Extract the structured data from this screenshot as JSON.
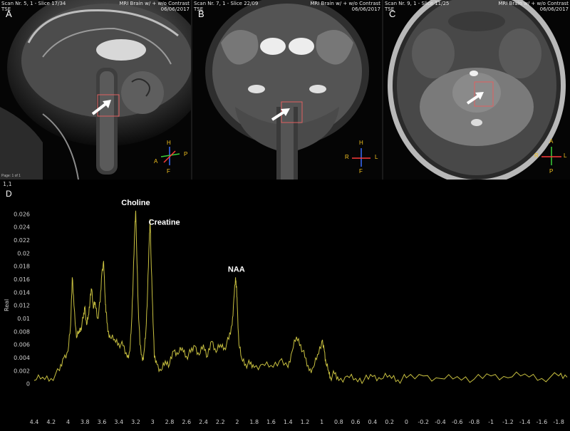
{
  "panels": [
    {
      "id": "A",
      "label": "A",
      "header_left_1": "Scan Nr. 5, 1 - Slice 17/34",
      "header_left_2": "TSE",
      "header_right_1": "MRI Brain w/ + w/o Contrast",
      "header_right_2": "06/06/2017",
      "orientation": {
        "top": "H",
        "left": "A",
        "right": "P",
        "bottom": "F"
      },
      "page_text": "Page: 1 of 1"
    },
    {
      "id": "B",
      "label": "B",
      "header_left_1": "Scan Nr. 7, 1 - Slice 22/09",
      "header_left_2": "TSE",
      "header_right_1": "MRI Brain w/ + w/o Contrast",
      "header_right_2": "06/06/2017",
      "orientation": {
        "top": "H",
        "left": "R",
        "right": "L",
        "bottom": "F"
      }
    },
    {
      "id": "C",
      "label": "C",
      "header_left_1": "Scan Nr. 9, 1 - Slice 11/25",
      "header_left_2": "TSE",
      "header_right_1": "MRI Brain w/ + w/o Contrast",
      "header_right_2": "06/06/2017",
      "orientation": {
        "top": "A",
        "left": "R",
        "right": "L",
        "bottom": "P"
      }
    }
  ],
  "spectrum": {
    "label": "D",
    "corner_text": "1,1",
    "ylabel": "Real",
    "peaks": [
      {
        "name": "Choline",
        "ppm": 3.2
      },
      {
        "name": "Creatine",
        "ppm": 3.03
      },
      {
        "name": "NAA",
        "ppm": 2.01
      }
    ]
  },
  "chart_data": {
    "type": "line",
    "title": "",
    "xlabel": "",
    "ylabel": "Real",
    "xlim": [
      4.4,
      -1.9
    ],
    "ylim": [
      -0.002,
      0.028
    ],
    "x_reversed": true,
    "xticks": [
      "4.4",
      "4.2",
      "4",
      "3.8",
      "3.6",
      "3.4",
      "3.2",
      "3",
      "2.8",
      "2.6",
      "2.4",
      "2.2",
      "2",
      "1.8",
      "1.6",
      "1.4",
      "1.2",
      "1",
      "0.8",
      "0.6",
      "0.4",
      "0.2",
      "0",
      "-0.2",
      "-0.4",
      "-0.6",
      "-0.8",
      "-1",
      "-1.2",
      "-1.4",
      "-1.6",
      "-1.8"
    ],
    "yticks": [
      "0",
      "0.002",
      "0.004",
      "0.006",
      "0.008",
      "0.01",
      "0.012",
      "0.014",
      "0.016",
      "0.018",
      "0.02",
      "0.022",
      "0.024",
      "0.026"
    ],
    "line_color": "#c8c040",
    "series": [
      {
        "x": [
          4.4,
          4.3,
          4.2,
          4.1,
          4.05,
          4.0,
          3.97,
          3.95,
          3.93,
          3.9,
          3.87,
          3.85,
          3.82,
          3.8,
          3.78,
          3.76,
          3.74,
          3.72,
          3.7,
          3.68,
          3.65,
          3.62,
          3.6,
          3.58,
          3.56,
          3.55,
          3.53,
          3.5,
          3.45,
          3.4,
          3.35,
          3.3,
          3.27,
          3.25,
          3.23,
          3.21,
          3.2,
          3.19,
          3.17,
          3.15,
          3.12,
          3.1,
          3.08,
          3.06,
          3.04,
          3.03,
          3.02,
          3.0,
          2.98,
          2.95,
          2.9,
          2.85,
          2.8,
          2.75,
          2.7,
          2.65,
          2.6,
          2.55,
          2.5,
          2.45,
          2.4,
          2.35,
          2.3,
          2.25,
          2.2,
          2.15,
          2.1,
          2.06,
          2.04,
          2.02,
          2.01,
          2.0,
          1.98,
          1.95,
          1.9,
          1.85,
          1.8,
          1.7,
          1.6,
          1.5,
          1.4,
          1.35,
          1.3,
          1.25,
          1.2,
          1.15,
          1.1,
          1.05,
          1.0,
          0.97,
          0.95,
          0.92,
          0.9,
          0.85,
          0.8,
          0.7,
          0.6,
          0.5,
          0.4,
          0.3,
          0.2,
          0.1,
          0.0,
          -0.2,
          -0.4,
          -0.6,
          -0.8,
          -1.0,
          -1.2,
          -1.4,
          -1.6,
          -1.8,
          -1.9
        ],
        "y": [
          0.0005,
          0.001,
          0.0008,
          0.002,
          0.004,
          0.005,
          0.009,
          0.0163,
          0.012,
          0.007,
          0.008,
          0.0085,
          0.01,
          0.0118,
          0.009,
          0.0105,
          0.0128,
          0.0145,
          0.0115,
          0.0125,
          0.01,
          0.0125,
          0.017,
          0.0188,
          0.013,
          0.011,
          0.008,
          0.007,
          0.0068,
          0.0062,
          0.0058,
          0.004,
          0.005,
          0.009,
          0.016,
          0.024,
          0.0265,
          0.021,
          0.012,
          0.006,
          0.0035,
          0.005,
          0.008,
          0.014,
          0.022,
          0.0252,
          0.02,
          0.012,
          0.004,
          0.003,
          0.002,
          0.0035,
          0.003,
          0.005,
          0.0045,
          0.0055,
          0.0042,
          0.0048,
          0.0058,
          0.0044,
          0.006,
          0.0042,
          0.0065,
          0.0048,
          0.006,
          0.0055,
          0.0068,
          0.009,
          0.013,
          0.0163,
          0.015,
          0.012,
          0.006,
          0.004,
          0.003,
          0.003,
          0.0025,
          0.003,
          0.0028,
          0.0035,
          0.0025,
          0.005,
          0.0072,
          0.006,
          0.004,
          0.002,
          0.0025,
          0.0045,
          0.0065,
          0.005,
          0.003,
          0.002,
          0.001,
          0.0015,
          0.0005,
          0.0012,
          0.0008,
          0.0006,
          0.0011,
          0.0007,
          0.0013,
          0.0006,
          0.0009,
          0.0012,
          0.0008,
          0.0011,
          0.0007,
          0.0012,
          0.0009,
          0.0015,
          0.0008,
          0.0012,
          0.001
        ]
      }
    ]
  }
}
